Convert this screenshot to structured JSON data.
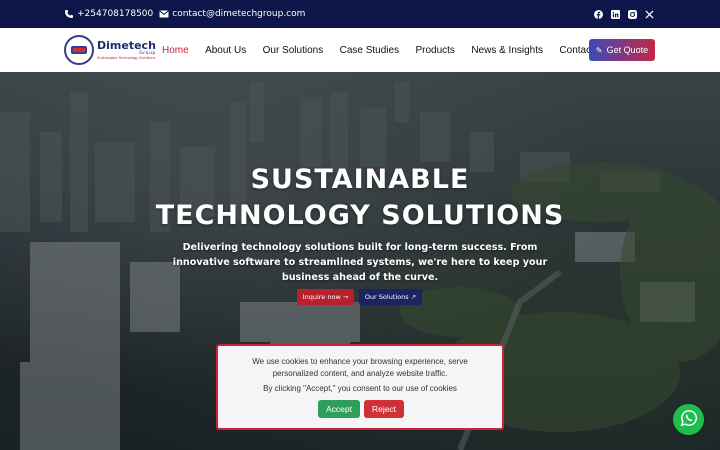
{
  "topbar": {
    "phone": "+254708178500",
    "email": "contact@dimetechgroup.com",
    "phone_icon": "phone-icon",
    "email_icon": "envelope-icon",
    "social": [
      "facebook-icon",
      "linkedin-icon",
      "instagram-icon",
      "x-icon"
    ]
  },
  "logo": {
    "name": "Dimetech",
    "group": "Group",
    "tagline": "Sustainable Technology Solutions"
  },
  "nav": {
    "items": [
      "Home",
      "About Us",
      "Our Solutions",
      "Case Studies",
      "Products",
      "News & Insights",
      "Contact"
    ],
    "active": "Home",
    "cta": "Get Quote"
  },
  "hero": {
    "title_line1": "SUSTAINABLE",
    "title_line2": "TECHNOLOGY SOLUTIONS",
    "subtitle": "Delivering technology solutions built for long-term success. From innovative software to streamlined systems, we're here to keep your business ahead of the curve.",
    "btn_inquire": "Inquire now →",
    "btn_solutions": "Our Solutions ↗"
  },
  "cookie": {
    "text1": "We use cookies to enhance your browsing experience, serve personalized content, and analyze website traffic.",
    "text2": "By clicking \"Accept,\" you consent to our use of cookies",
    "accept": "Accept",
    "reject": "Reject"
  },
  "colors": {
    "topbar": "#0e1548",
    "accent_red": "#c8233a",
    "navy": "#1d2360",
    "accept_green": "#2e9f5b",
    "whatsapp_green": "#1fbc4e"
  },
  "floating": {
    "icon": "whatsapp-icon"
  }
}
